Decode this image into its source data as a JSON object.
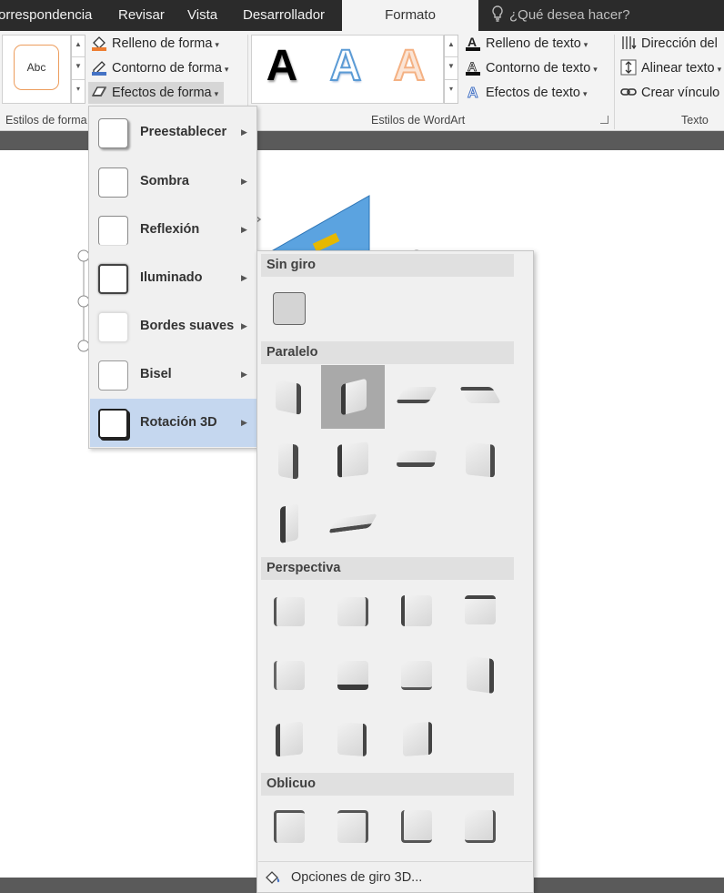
{
  "tabs": [
    "orrespondencia",
    "Revisar",
    "Vista",
    "Desarrollador",
    "Formato"
  ],
  "tell_me": "¿Qué desea hacer?",
  "ribbon": {
    "style_sample": "Abc",
    "shape_fill": "Relleno de forma",
    "shape_outline": "Contorno de forma",
    "shape_effects": "Efectos de forma",
    "group_shape_styles": "Estilos de forma",
    "wordart_letter": "A",
    "text_fill": "Relleno de texto",
    "text_outline": "Contorno de texto",
    "text_effects": "Efectos de texto",
    "group_wordart": "Estilos de WordArt",
    "text_direction": "Dirección del",
    "align_text": "Alinear texto",
    "create_link": "Crear vínculo",
    "group_text": "Texto"
  },
  "effects_menu": {
    "items": [
      {
        "label": "Preestablecer"
      },
      {
        "label": "Sombra"
      },
      {
        "label": "Reflexión"
      },
      {
        "label": "Iluminado"
      },
      {
        "label": "Bordes suaves"
      },
      {
        "label": "Bisel"
      },
      {
        "label": "Rotación 3D"
      }
    ],
    "selected": "Rotación 3D"
  },
  "rotation_menu": {
    "sections": [
      "Sin giro",
      "Paralelo",
      "Perspectiva",
      "Oblicuo"
    ],
    "options_label": "Opciones de giro 3D..."
  },
  "colors": {
    "accent": "#4472c4",
    "tab_bar": "#2b2b2b",
    "ribbon": "#f3f3f3",
    "menu_selected": "#c5d7ef"
  }
}
